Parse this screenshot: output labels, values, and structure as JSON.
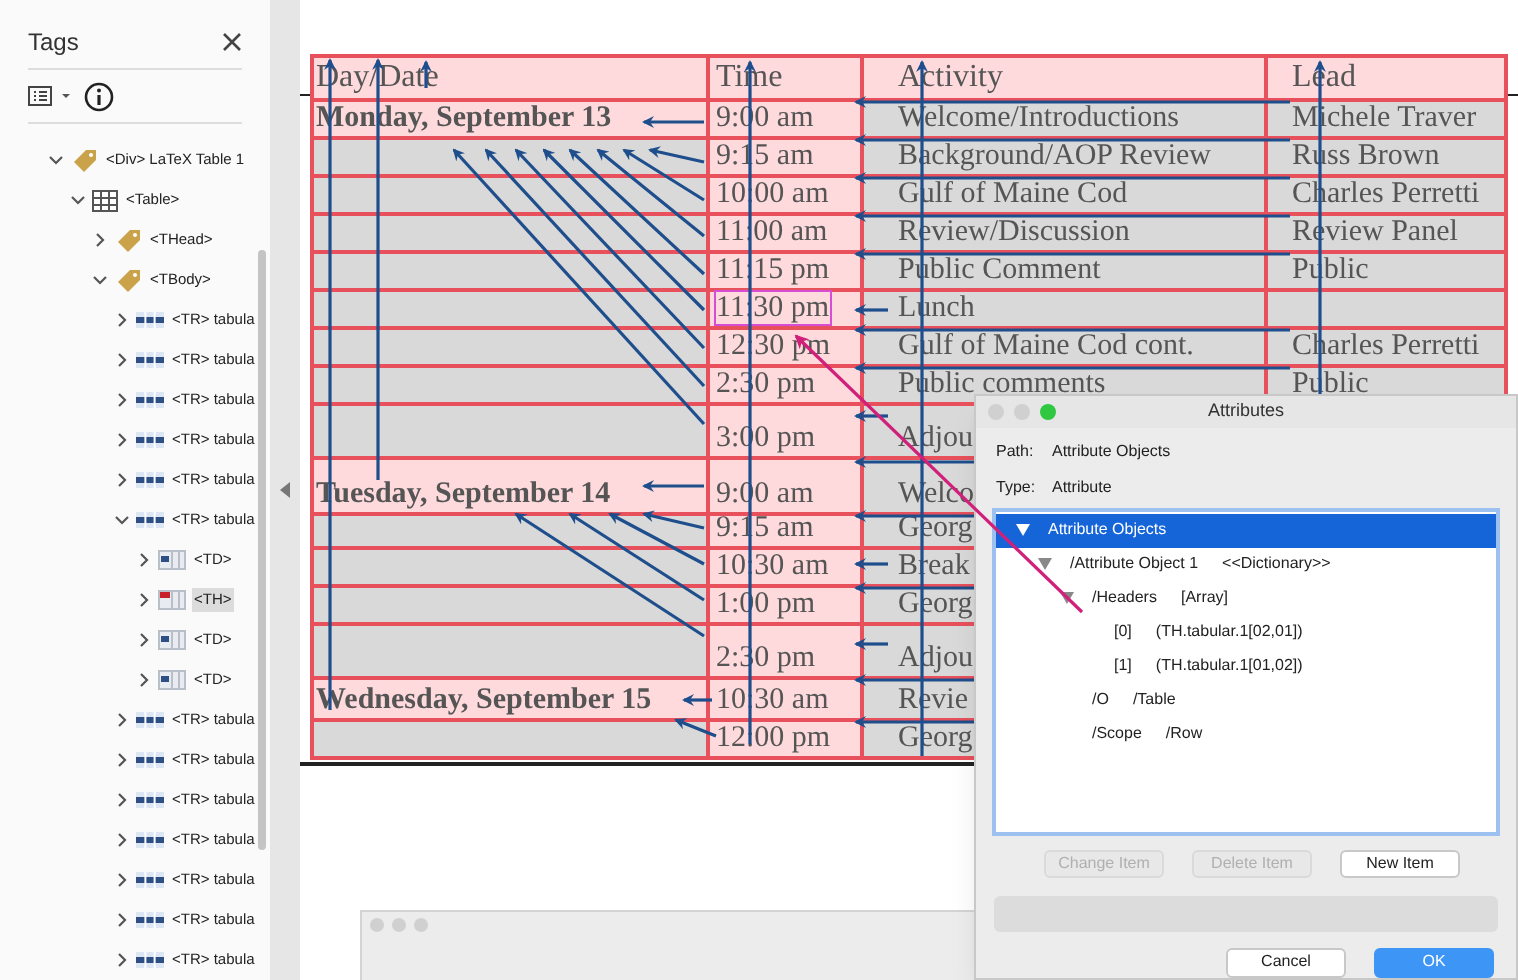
{
  "tags_panel": {
    "title": "Tags",
    "tree": [
      {
        "label": "<Div> LaTeX Table 1",
        "kind": "tag",
        "expanded": true,
        "selected": false,
        "children": [
          {
            "label": "<Table>",
            "kind": "table",
            "expanded": true,
            "selected": false,
            "children": [
              {
                "label": "<THead>",
                "kind": "tag",
                "expanded": false,
                "selected": false
              },
              {
                "label": "<TBody>",
                "kind": "tag",
                "expanded": true,
                "selected": false,
                "children": [
                  {
                    "label": "<TR> tabula",
                    "kind": "row",
                    "expanded": false,
                    "selected": false
                  },
                  {
                    "label": "<TR> tabula",
                    "kind": "row",
                    "expanded": false,
                    "selected": false
                  },
                  {
                    "label": "<TR> tabula",
                    "kind": "row",
                    "expanded": false,
                    "selected": false
                  },
                  {
                    "label": "<TR> tabula",
                    "kind": "row",
                    "expanded": false,
                    "selected": false
                  },
                  {
                    "label": "<TR> tabula",
                    "kind": "row",
                    "expanded": false,
                    "selected": false
                  },
                  {
                    "label": "<TR> tabula",
                    "kind": "row",
                    "expanded": true,
                    "selected": false,
                    "children": [
                      {
                        "label": "<TD>",
                        "kind": "cell",
                        "expanded": false,
                        "selected": false
                      },
                      {
                        "label": "<TH>",
                        "kind": "header-cell",
                        "expanded": false,
                        "selected": true
                      },
                      {
                        "label": "<TD>",
                        "kind": "cell",
                        "expanded": false,
                        "selected": false
                      },
                      {
                        "label": "<TD>",
                        "kind": "cell",
                        "expanded": false,
                        "selected": false
                      }
                    ]
                  },
                  {
                    "label": "<TR> tabula",
                    "kind": "row",
                    "expanded": false,
                    "selected": false
                  },
                  {
                    "label": "<TR> tabula",
                    "kind": "row",
                    "expanded": false,
                    "selected": false
                  },
                  {
                    "label": "<TR> tabula",
                    "kind": "row",
                    "expanded": false,
                    "selected": false
                  },
                  {
                    "label": "<TR> tabula",
                    "kind": "row",
                    "expanded": false,
                    "selected": false
                  },
                  {
                    "label": "<TR> tabula",
                    "kind": "row",
                    "expanded": false,
                    "selected": false
                  },
                  {
                    "label": "<TR> tabula",
                    "kind": "row",
                    "expanded": false,
                    "selected": false
                  },
                  {
                    "label": "<TR> tabula",
                    "kind": "row",
                    "expanded": false,
                    "selected": false
                  }
                ]
              }
            ]
          }
        ]
      }
    ]
  },
  "table": {
    "columns": [
      "Day/Date",
      "Time",
      "Activity",
      "Lead"
    ],
    "rows": [
      {
        "day": "Monday, September 13",
        "time": "9:00 am",
        "activity": "Welcome/Introductions",
        "lead": "Michele Traver",
        "highlighted": false
      },
      {
        "time": "9:15 am",
        "activity": "Background/AOP Review",
        "lead": "Russ Brown",
        "highlighted": false
      },
      {
        "time": "10:00 am",
        "activity": "Gulf of Maine Cod",
        "lead": "Charles Perretti",
        "highlighted": false
      },
      {
        "time": "11:00 am",
        "activity": "Review/Discussion",
        "lead": "Review Panel",
        "highlighted": false
      },
      {
        "time": "11:15 pm",
        "activity": "Public Comment",
        "lead": "Public",
        "highlighted": false
      },
      {
        "time": "11:30 pm",
        "activity": "Lunch",
        "highlighted": true
      },
      {
        "time": "12:30 pm",
        "activity": "Gulf of Maine Cod cont.",
        "lead": "Charles Perretti",
        "highlighted": false
      },
      {
        "time": "2:30 pm",
        "activity": "Public comments",
        "lead": "Public",
        "highlighted": false
      },
      {
        "time": "3:00 pm",
        "activity": "Adjou",
        "highlighted": false
      },
      {
        "day": "Tuesday, September 14",
        "time": "9:00 am",
        "activity": "Welco",
        "highlighted": false
      },
      {
        "time": "9:15 am",
        "activity": "Georg",
        "highlighted": false
      },
      {
        "time": "10:30 am",
        "activity": "Break",
        "highlighted": false
      },
      {
        "time": "1:00 pm",
        "activity": "Georg",
        "highlighted": false
      },
      {
        "time": "2:30 pm",
        "activity": "Adjou",
        "highlighted": false
      },
      {
        "day": "Wednesday, September 15",
        "time": "10:30 am",
        "activity": "Revie",
        "highlighted": false
      },
      {
        "time": "12:00 pm",
        "activity": "Georg",
        "highlighted": false
      }
    ]
  },
  "dialog": {
    "title": "Attributes",
    "path_label": "Path:",
    "path": "Attribute Objects",
    "type_label": "Type:",
    "type": "Attribute",
    "tree": [
      {
        "label": "Attribute Objects",
        "selected": true,
        "expanded": true,
        "children": [
          {
            "label": "/Attribute Object  1",
            "value": "<<Dictionary>>",
            "selected": false,
            "expanded": true,
            "children": [
              {
                "label": "/Headers",
                "value": "[Array]",
                "selected": false,
                "expanded": true,
                "children": [
                  {
                    "label": "[0]",
                    "value": "(TH.tabular.1[02,01])",
                    "selected": false
                  },
                  {
                    "label": "[1]",
                    "value": "(TH.tabular.1[01,02])",
                    "selected": false
                  }
                ]
              },
              {
                "label": "/O",
                "value": "/Table",
                "selected": false
              },
              {
                "label": "/Scope",
                "value": "/Row",
                "selected": false
              }
            ]
          }
        ]
      }
    ],
    "item_buttons": [
      {
        "label": "Change Item",
        "disabled": true
      },
      {
        "label": "Delete Item",
        "disabled": true
      },
      {
        "label": "New Item",
        "disabled": false
      }
    ],
    "buttons": [
      {
        "label": "Cancel",
        "default": false
      },
      {
        "label": "OK",
        "default": true
      }
    ]
  }
}
